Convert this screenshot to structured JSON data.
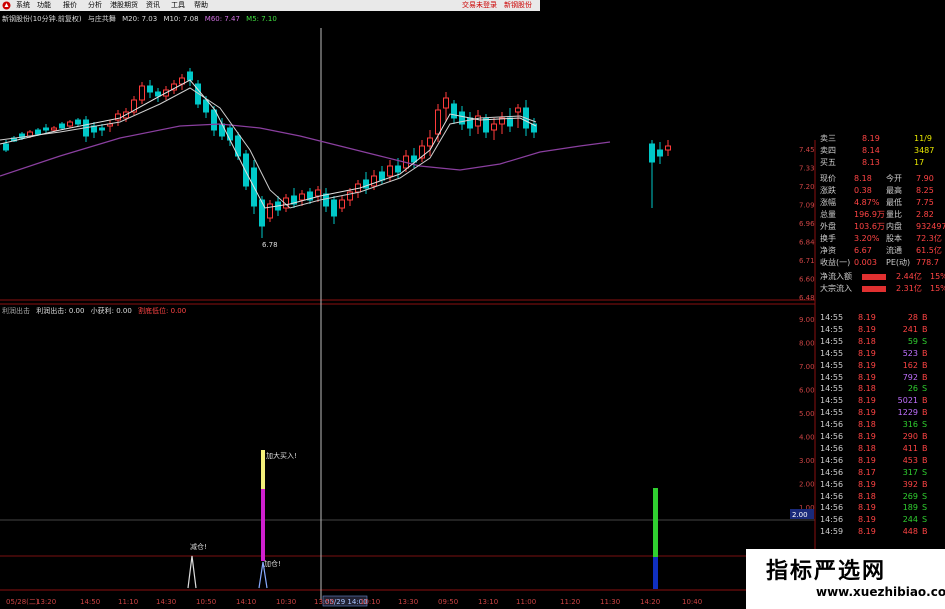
{
  "menubar": {
    "items": [
      "系统",
      "功能",
      "报价",
      "分析",
      "港股期货",
      "资讯",
      "工具",
      "帮助"
    ],
    "right_labels": [
      "交易未登录",
      "新钢股份"
    ]
  },
  "chart_title": {
    "stock": "新钢股份(10分钟.前复权)",
    "formula": "与庄共舞",
    "ma20": "M20: 7.03",
    "ma10": "M10: 7.08",
    "ma60": "M60: 7.47",
    "ma5": "M5: 7.10"
  },
  "price_chart": {
    "low_label": "6.78",
    "y_labels": [
      "7.45",
      "7.33",
      "7.20",
      "7.09",
      "6.96",
      "6.84",
      "6.71",
      "6.60",
      "6.48"
    ]
  },
  "indicator": {
    "name": "利润出击",
    "params": [
      {
        "label": "利润出击: 0.00",
        "color": "#dddddd"
      },
      {
        "label": "小获利: 0.00",
        "color": "#dddddd"
      },
      {
        "label": "割底低位: 0.00",
        "color": "#ff4444"
      }
    ],
    "signals": [
      "减仓!",
      "加大买入!",
      "加仓!"
    ],
    "y_labels": [
      "9.00",
      "8.00",
      "7.00",
      "6.00",
      "5.00",
      "4.00",
      "3.00",
      "2.00",
      "1.00"
    ],
    "current_value": "2.00",
    "cursor_time": "05/29 14:00"
  },
  "time_axis": [
    "05/28(二)",
    "13:20",
    "14:50",
    "11:10",
    "14:30",
    "10:50",
    "14:10",
    "10:30",
    "13:50",
    "10:10",
    "13:30",
    "09:50",
    "13:10",
    "11:00",
    "11:20",
    "11:30",
    "14:20",
    "10:40"
  ],
  "quote": {
    "order_book": [
      {
        "label": "卖三",
        "price": "8.19",
        "vol": "11/9"
      },
      {
        "label": "卖四",
        "price": "8.14",
        "vol": "3487"
      },
      {
        "label": "买五",
        "price": "8.13",
        "vol": "17"
      }
    ],
    "stats": [
      {
        "l1": "现价",
        "v1": "8.18",
        "l2": "今开",
        "v2": "7.90"
      },
      {
        "l1": "涨跌",
        "v1": "0.38",
        "l2": "最高",
        "v2": "8.25"
      },
      {
        "l1": "涨幅",
        "v1": "4.87%",
        "l2": "最低",
        "v2": "7.75"
      },
      {
        "l1": "总量",
        "v1": "196.9万",
        "l2": "量比",
        "v2": "2.82"
      },
      {
        "l1": "外盘",
        "v1": "103.6万",
        "l2": "内盘",
        "v2": "932497"
      },
      {
        "l1": "换手",
        "v1": "3.20%",
        "l2": "股本",
        "v2": "72.3亿"
      },
      {
        "l1": "净资",
        "v1": "6.67",
        "l2": "流通",
        "v2": "61.5亿"
      },
      {
        "l1": "收益(一)",
        "v1": "0.003",
        "l2": "PE(动)",
        "v2": "778.7"
      }
    ],
    "flows": [
      {
        "label": "净流入额",
        "value": "2.44亿",
        "pct": "15%"
      },
      {
        "label": "大宗流入",
        "value": "2.31亿",
        "pct": "15%"
      }
    ]
  },
  "ticks": [
    {
      "time": "14:55",
      "price": "8.19",
      "vol": "28",
      "side": "B"
    },
    {
      "time": "14:55",
      "price": "8.19",
      "vol": "241",
      "side": "B"
    },
    {
      "time": "14:55",
      "price": "8.18",
      "vol": "59",
      "side": "S"
    },
    {
      "time": "14:55",
      "price": "8.19",
      "vol": "523",
      "side": "B"
    },
    {
      "time": "14:55",
      "price": "8.19",
      "vol": "162",
      "side": "B"
    },
    {
      "time": "14:55",
      "price": "8.19",
      "vol": "792",
      "side": "B"
    },
    {
      "time": "14:55",
      "price": "8.18",
      "vol": "26",
      "side": "S"
    },
    {
      "time": "14:55",
      "price": "8.19",
      "vol": "5021",
      "side": "B"
    },
    {
      "time": "14:55",
      "price": "8.19",
      "vol": "1229",
      "side": "B"
    },
    {
      "time": "14:56",
      "price": "8.18",
      "vol": "316",
      "side": "S"
    },
    {
      "time": "14:56",
      "price": "8.19",
      "vol": "290",
      "side": "B"
    },
    {
      "time": "14:56",
      "price": "8.18",
      "vol": "411",
      "side": "B"
    },
    {
      "time": "14:56",
      "price": "8.19",
      "vol": "453",
      "side": "B"
    },
    {
      "time": "14:56",
      "price": "8.17",
      "vol": "317",
      "side": "S"
    },
    {
      "time": "14:56",
      "price": "8.19",
      "vol": "392",
      "side": "B"
    },
    {
      "time": "14:56",
      "price": "8.18",
      "vol": "269",
      "side": "S"
    },
    {
      "time": "14:56",
      "price": "8.19",
      "vol": "189",
      "side": "S"
    },
    {
      "time": "14:56",
      "price": "8.19",
      "vol": "244",
      "side": "S"
    },
    {
      "time": "14:59",
      "price": "8.19",
      "vol": "448",
      "side": "B"
    }
  ],
  "watermark": {
    "cn": "指标严选网",
    "url": "www.xuezhibiao.com"
  },
  "colors": {
    "up": "#ff3b3b",
    "down": "#00c8c8",
    "ma60": "#8a3f9f",
    "ma_line": "#dddddd",
    "bar_yellow": "#f4f07a",
    "bar_magenta": "#d020d0",
    "bar_green": "#30d030",
    "bar_blue": "#1030c0"
  }
}
